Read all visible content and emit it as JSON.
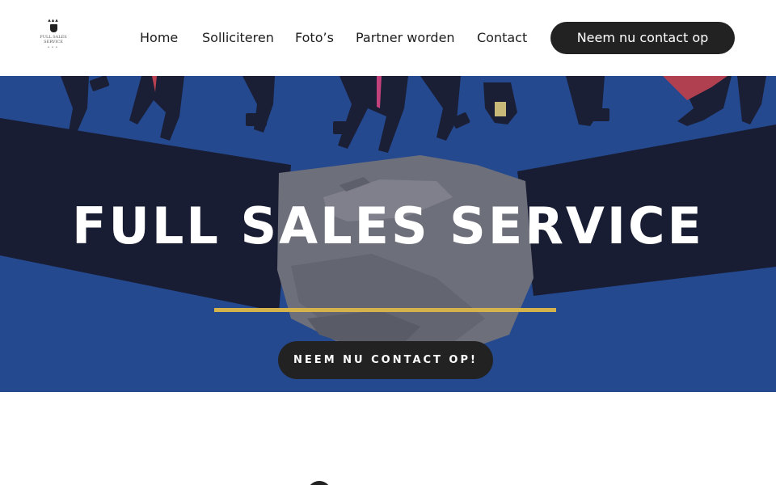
{
  "logo": {
    "name_line1": "FULL SALES",
    "name_line2": "SERVICE"
  },
  "nav": {
    "items": [
      "Home",
      "Solliciteren",
      "Foto’s",
      "Partner worden",
      "Contact"
    ],
    "cta_label": "Neem nu contact op"
  },
  "hero": {
    "title": "FULL SALES SERVICE",
    "cta_label": "NEEM NU CONTACT OP!",
    "accent_color": "#d4b24c",
    "background_color": "#24498f"
  },
  "icons": {
    "logo": "crest-logo-icon",
    "below": "circle-icon"
  }
}
